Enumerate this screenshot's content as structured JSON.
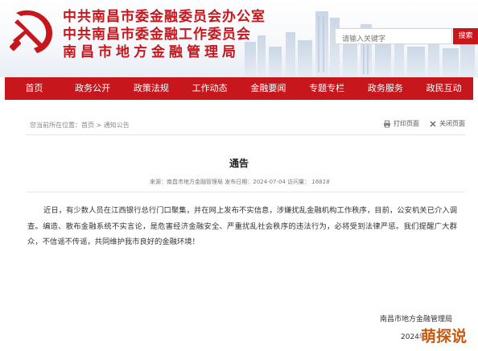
{
  "header": {
    "titles": [
      "中共南昌市委金融委员会办公室",
      "中共南昌市委金融工作委员会",
      "南昌市地方金融管理局"
    ],
    "search_placeholder": "请输入关键字",
    "search_button": "搜索"
  },
  "nav": [
    "首页",
    "政务公开",
    "政策法规",
    "工作动态",
    "金融要闻",
    "专题专栏",
    "政务服务",
    "政民互动"
  ],
  "breadcrumb": "您当前所在位置：首页 > 通知公告",
  "tools": {
    "print": "打印页面",
    "close": "关闭页面"
  },
  "article": {
    "title": "通告",
    "meta": {
      "source_label": "来源：",
      "source": "南昌市地方金融管理局",
      "date_label": "发布日期：",
      "date": "2024-07-04",
      "visits_label": "访问量：",
      "visits": "16818"
    },
    "body": "近日，有少数人员在江西银行总行门口聚集，并在网上发布不实信息，涉嫌扰乱金融机构工作秩序，目前，公安机关已介入调查。编造、散布金融系统不实言论，是危害经济金融安全、严重扰乱社会秩序的违法行为，必将受到法律严惩。我们提醒广大群众，不信谣不传谣，共同维护我市良好的金融环境！",
    "signature": "南昌市地方金融管理局",
    "sign_date": "2024年"
  },
  "watermark": "萌探说",
  "colors": {
    "brand_red": "#c8161d",
    "watermark": "#c85a10"
  }
}
